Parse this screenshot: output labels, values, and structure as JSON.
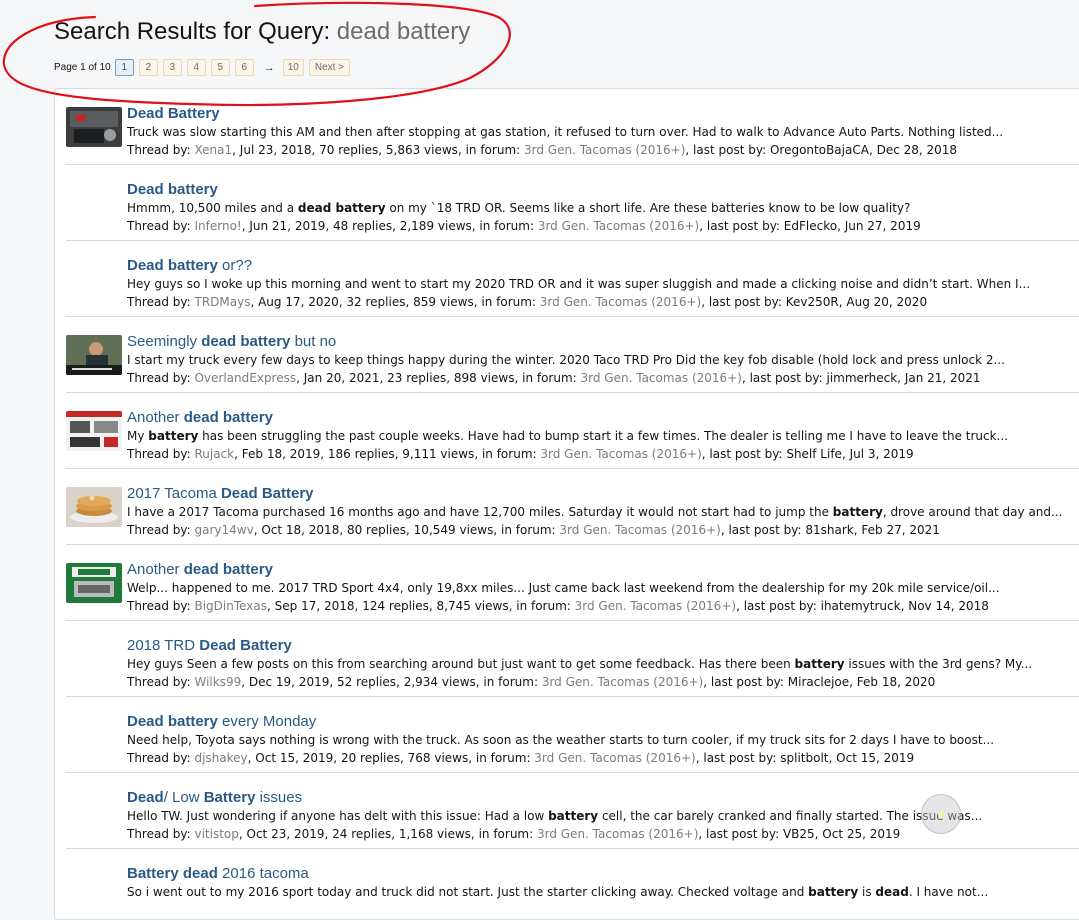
{
  "header": {
    "title_prefix": "Search Results for Query: ",
    "query": "dead battery"
  },
  "pagination": {
    "label": "Page 1 of 10",
    "pages": [
      "1",
      "2",
      "3",
      "4",
      "5",
      "6"
    ],
    "current": "1",
    "arrow": "→",
    "last": "10",
    "next_label": "Next >"
  },
  "results": [
    {
      "title": [
        {
          "t": "Dead Battery",
          "b": true
        }
      ],
      "snippet": [
        {
          "t": "Truck was slow starting this AM and then after stopping at gas station, it refused to turn over. Had to walk to Advance Auto Parts. Nothing listed...",
          "b": false
        }
      ],
      "author": "Xena1",
      "date": "Jul 23, 2018",
      "replies": "70 replies",
      "views": "5,863 views",
      "forum": "3rd Gen. Tacomas (2016+)",
      "last_poster": "OregontoBajaCA",
      "last_date": "Dec 28, 2018",
      "thumb": "engine-battery-photo"
    },
    {
      "title": [
        {
          "t": "Dead battery",
          "b": true
        }
      ],
      "snippet": [
        {
          "t": "Hmmm, 10,500 miles and a ",
          "b": false
        },
        {
          "t": "dead battery",
          "b": true
        },
        {
          "t": " on my `18 TRD OR. Seems like a short life. Are these batteries know to be low quality?",
          "b": false
        }
      ],
      "author": "Inferno!",
      "date": "Jun 21, 2019",
      "replies": "48 replies",
      "views": "2,189 views",
      "forum": "3rd Gen. Tacomas (2016+)",
      "last_poster": "EdFlecko",
      "last_date": "Jun 27, 2019",
      "thumb": ""
    },
    {
      "title": [
        {
          "t": "Dead battery",
          "b": true
        },
        {
          "t": " or??",
          "b": false
        }
      ],
      "snippet": [
        {
          "t": "Hey guys so I woke up this morning and went to start my 2020 TRD OR and it was super sluggish and made a clicking noise and didn’t start. When I...",
          "b": false
        }
      ],
      "author": "TRDMays",
      "date": "Aug 17, 2020",
      "replies": "32 replies",
      "views": "859 views",
      "forum": "3rd Gen. Tacomas (2016+)",
      "last_poster": "Kev250R",
      "last_date": "Aug 20, 2020",
      "thumb": ""
    },
    {
      "title": [
        {
          "t": "Seemingly ",
          "b": false
        },
        {
          "t": "dead battery",
          "b": true
        },
        {
          "t": " but no",
          "b": false
        }
      ],
      "snippet": [
        {
          "t": "I start my truck every few days to keep things happy during the winter. 2020 Taco TRD Pro Did the key fob disable (hold lock and press unlock 2...",
          "b": false
        }
      ],
      "author": "OverlandExpress",
      "date": "Jan 20, 2021",
      "replies": "23 replies",
      "views": "898 views",
      "forum": "3rd Gen. Tacomas (2016+)",
      "last_poster": "jimmerheck",
      "last_date": "Jan 21, 2021",
      "thumb": "meme-photo"
    },
    {
      "title": [
        {
          "t": "Another ",
          "b": false
        },
        {
          "t": "dead battery",
          "b": true
        }
      ],
      "snippet": [
        {
          "t": "My ",
          "b": false
        },
        {
          "t": "battery",
          "b": true
        },
        {
          "t": " has been struggling the past couple weeks. Have had to bump start it a few times. The dealer is telling me I have to leave the truck...",
          "b": false
        }
      ],
      "author": "Rujack",
      "date": "Feb 18, 2019",
      "replies": "186 replies",
      "views": "9,111 views",
      "forum": "3rd Gen. Tacomas (2016+)",
      "last_poster": "Shelf Life",
      "last_date": "Jul 3, 2019",
      "thumb": "product-screenshot"
    },
    {
      "title": [
        {
          "t": "2017 Tacoma ",
          "b": false
        },
        {
          "t": "Dead Battery",
          "b": true
        }
      ],
      "snippet": [
        {
          "t": "I have a 2017 Tacoma purchased 16 months ago and have 12,700 miles. Saturday it would not start had to jump the ",
          "b": false
        },
        {
          "t": "battery",
          "b": true
        },
        {
          "t": ", drove around that day and...",
          "b": false
        }
      ],
      "author": "gary14wv",
      "date": "Oct 18, 2018",
      "replies": "80 replies",
      "views": "10,549 views",
      "forum": "3rd Gen. Tacomas (2016+)",
      "last_poster": "81shark",
      "last_date": "Feb 27, 2021",
      "thumb": "pancake-photo"
    },
    {
      "title": [
        {
          "t": "Another ",
          "b": false
        },
        {
          "t": "dead battery",
          "b": true
        }
      ],
      "snippet": [
        {
          "t": "Welp... happened to me. 2017 TRD Sport 4x4, only 19,8xx miles... Just came back last weekend from the dealership for my 20k mile service/oil...",
          "b": false
        }
      ],
      "author": "BigDinTexas",
      "date": "Sep 17, 2018",
      "replies": "124 replies",
      "views": "8,745 views",
      "forum": "3rd Gen. Tacomas (2016+)",
      "last_poster": "ihatemytruck",
      "last_date": "Nov 14, 2018",
      "thumb": "gel-product-photo"
    },
    {
      "title": [
        {
          "t": "2018 TRD ",
          "b": false
        },
        {
          "t": "Dead Battery",
          "b": true
        }
      ],
      "snippet": [
        {
          "t": "Hey guys Seen a few posts on this from searching around but just want to get some feedback. Has there been ",
          "b": false
        },
        {
          "t": "battery",
          "b": true
        },
        {
          "t": " issues with the 3rd gens? My...",
          "b": false
        }
      ],
      "author": "Wilks99",
      "date": "Dec 19, 2019",
      "replies": "52 replies",
      "views": "2,934 views",
      "forum": "3rd Gen. Tacomas (2016+)",
      "last_poster": "Miraclejoe",
      "last_date": "Feb 18, 2020",
      "thumb": ""
    },
    {
      "title": [
        {
          "t": "Dead battery",
          "b": true
        },
        {
          "t": " every Monday",
          "b": false
        }
      ],
      "snippet": [
        {
          "t": "Need help, Toyota says nothing is wrong with the truck. As soon as the weather starts to turn cooler, if my truck sits for 2 days I have to boost...",
          "b": false
        }
      ],
      "author": "djshakey",
      "date": "Oct 15, 2019",
      "replies": "20 replies",
      "views": "768 views",
      "forum": "3rd Gen. Tacomas (2016+)",
      "last_poster": "splitbolt",
      "last_date": "Oct 15, 2019",
      "thumb": ""
    },
    {
      "title": [
        {
          "t": "Dead",
          "b": true
        },
        {
          "t": "/ Low ",
          "b": false
        },
        {
          "t": "Battery",
          "b": true
        },
        {
          "t": " issues",
          "b": false
        }
      ],
      "snippet": [
        {
          "t": "Hello TW. Just wondering if anyone has delt with this issue: Had a low ",
          "b": false
        },
        {
          "t": "battery",
          "b": true
        },
        {
          "t": " cell, the car barely cranked and finally started. The issue was...",
          "b": false
        }
      ],
      "author": "vitistop",
      "date": "Oct 23, 2019",
      "replies": "24 replies",
      "views": "1,168 views",
      "forum": "3rd Gen. Tacomas (2016+)",
      "last_poster": "VB25",
      "last_date": "Oct 25, 2019",
      "thumb": ""
    },
    {
      "title": [
        {
          "t": "Battery dead",
          "b": true
        },
        {
          "t": " 2016 tacoma",
          "b": false
        }
      ],
      "snippet": [
        {
          "t": "So i went out to my 2016 sport today and truck did not start. Just the starter clicking away. Checked voltage and ",
          "b": false
        },
        {
          "t": "battery",
          "b": true
        },
        {
          "t": " is ",
          "b": false
        },
        {
          "t": "dead",
          "b": true
        },
        {
          "t": ". I have not...",
          "b": false
        }
      ],
      "author": "",
      "date": "",
      "replies": "",
      "views": "",
      "forum": "",
      "last_poster": "",
      "last_date": "",
      "thumb": ""
    }
  ],
  "labels": {
    "thread_by": "Thread by: ",
    "in_forum": "in forum: ",
    "last_post_by": "last post by: "
  },
  "colors": {
    "link": "#2a5a86",
    "meta_link": "#7c7c7c",
    "annotation": "#e0101a"
  }
}
